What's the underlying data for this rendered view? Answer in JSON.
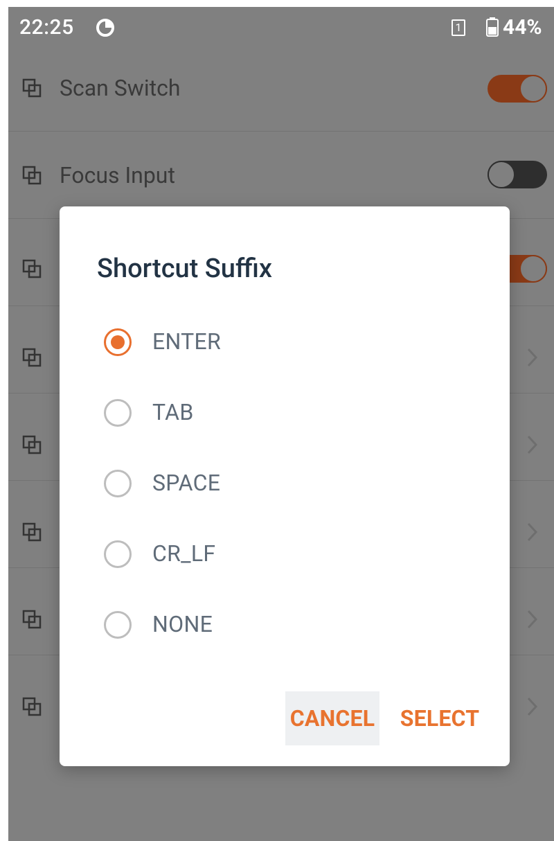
{
  "status_bar": {
    "time": "22:25",
    "sim_slot": "1",
    "battery_percent": "44%",
    "notification_icon": "data-saver-icon",
    "battery_icon": "battery-icon"
  },
  "settings": {
    "scan_switch": {
      "label": "Scan Switch",
      "enabled": true
    },
    "focus_input": {
      "label": "Focus Input",
      "enabled": false
    }
  },
  "dialog": {
    "title": "Shortcut Suffix",
    "options": [
      {
        "label": "ENTER",
        "selected": true
      },
      {
        "label": "TAB",
        "selected": false
      },
      {
        "label": "SPACE",
        "selected": false
      },
      {
        "label": "CR_LF",
        "selected": false
      },
      {
        "label": "NONE",
        "selected": false
      }
    ],
    "cancel_label": "CANCEL",
    "select_label": "SELECT"
  },
  "colors": {
    "accent": "#e86f2e",
    "scrim": "#808080",
    "title_text": "#223344",
    "option_text": "#5f6b78"
  }
}
